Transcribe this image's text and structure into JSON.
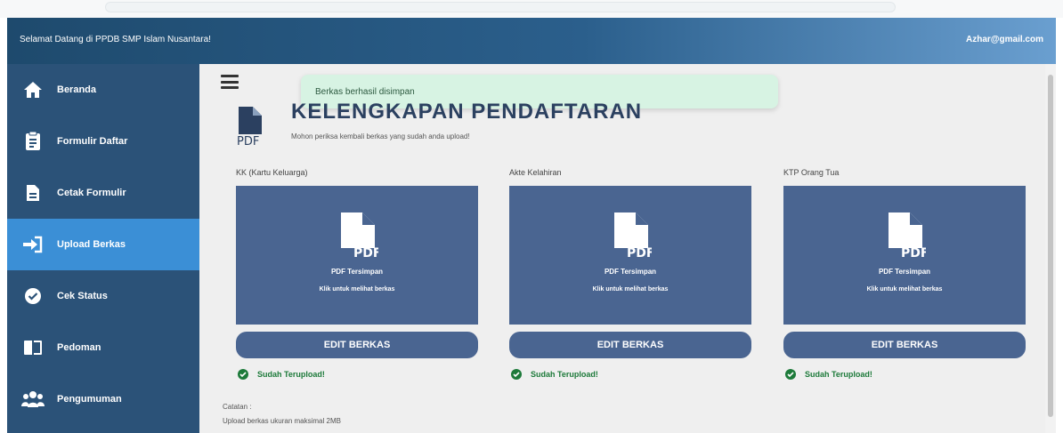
{
  "header": {
    "welcome": "Selamat Datang di PPDB SMP Islam Nusantara!",
    "email": "Azhar@gmail.com"
  },
  "sidebar": {
    "items": [
      {
        "label": "Beranda",
        "icon": "home-icon"
      },
      {
        "label": "Formulir Daftar",
        "icon": "form-icon"
      },
      {
        "label": "Cetak Formulir",
        "icon": "document-icon"
      },
      {
        "label": "Upload Berkas",
        "icon": "sign-in-icon",
        "active": true
      },
      {
        "label": "Cek Status",
        "icon": "check-circle-icon"
      },
      {
        "label": "Pedoman",
        "icon": "book-icon"
      },
      {
        "label": "Pengumuman",
        "icon": "users-icon"
      }
    ]
  },
  "toast": {
    "message": "Berkas berhasil disimpan"
  },
  "page": {
    "title": "KELENGKAPAN PENDAFTARAN",
    "subtitle": "Mohon periksa kembali berkas yang sudah anda upload!"
  },
  "documents": [
    {
      "label": "KK (Kartu Keluarga)",
      "stored": "PDF Tersimpan",
      "hint": "Klik untuk melihat berkas",
      "button": "EDIT BERKAS",
      "status": "Sudah Terupload!"
    },
    {
      "label": "Akte Kelahiran",
      "stored": "PDF Tersimpan",
      "hint": "Klik untuk melihat berkas",
      "button": "EDIT BERKAS",
      "status": "Sudah Terupload!"
    },
    {
      "label": "KTP Orang Tua",
      "stored": "PDF Tersimpan",
      "hint": "Klik untuk melihat berkas",
      "button": "EDIT BERKAS",
      "status": "Sudah Terupload!"
    }
  ],
  "notes": {
    "heading": "Catatan :",
    "line1": "Upload berkas ukuran maksimal 2MB"
  },
  "colors": {
    "sidebar_bg": "#2b5278",
    "sidebar_active": "#3b8fd6",
    "card_bg": "#4a6591",
    "toast_bg": "#d7f3e3",
    "success": "#1d7a3a"
  }
}
